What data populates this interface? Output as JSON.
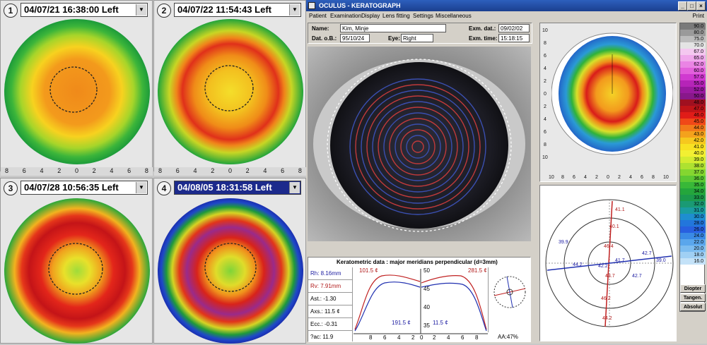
{
  "maps": [
    {
      "num": "1",
      "label": "04/07/21 16:38:00 Left"
    },
    {
      "num": "2",
      "label": "04/07/22 11:54:43 Left"
    },
    {
      "num": "3",
      "label": "04/07/28 10:56:35 Left"
    },
    {
      "num": "4",
      "label": "04/08/05 18:31:58 Left"
    }
  ],
  "scale_ticks": [
    "8",
    "6",
    "4",
    "2",
    "0",
    "2",
    "4",
    "6",
    "8"
  ],
  "window": {
    "title": "OCULUS  -  KERATOGRAPH",
    "print": "Print"
  },
  "menu": [
    "Patient",
    "Examination",
    "Display",
    "Lens fitting",
    "Settings",
    "Miscellaneous"
  ],
  "patient": {
    "name_label": "Name:",
    "name": "Kim, Minje",
    "dob_label": "Dat. o.B.:",
    "dob": "95/10/24",
    "eye_label": "Eye:",
    "eye": "Right",
    "exam_date_label": "Exm. dat.:",
    "exam_date": "09/02/02",
    "exam_time_label": "Exm. time:",
    "exam_time": "15:18:15"
  },
  "kerato": {
    "title": "Keratometric data : major meridians perpendicular (d=3mm)",
    "rows": [
      "Rh:  8.16mm",
      "Rv:  7.91mm",
      "Ast.:  -1.30",
      "Axs.:  11.5 ¢",
      "Ecc.:  -0.31",
      "?ac: 11.9"
    ],
    "left_top": "101.5 ¢",
    "left_bottom": "191.5 ¢",
    "right_top": "281.5 ¢",
    "right_bottom": "11.5 ¢",
    "y_ticks": [
      "50",
      "45",
      "40",
      "35"
    ],
    "x_left": [
      "8",
      "6",
      "4",
      "2",
      "0"
    ],
    "x_right": [
      "2",
      "4",
      "6",
      "8"
    ],
    "aa": "AA:47%"
  },
  "topo_axis": {
    "left": [
      "10",
      "8",
      "6",
      "4",
      "2",
      "0",
      "2",
      "4",
      "6",
      "8",
      "10"
    ],
    "bottom": [
      "10",
      "8",
      "6",
      "4",
      "2",
      "0",
      "2",
      "4",
      "6",
      "8",
      "10"
    ]
  },
  "ring_values": [
    "41.1",
    "40.1",
    "46.4",
    "41.7",
    "42.7",
    "43.7",
    "42.2",
    "39.9",
    "44.2",
    "42.7",
    "39.0",
    "44.2",
    "46.2"
  ],
  "legend": [
    "90.0",
    "80.0",
    "75.0",
    "70.0",
    "67.0",
    "65.0",
    "62.0",
    "60.0",
    "57.0",
    "55.0",
    "52.0",
    "50.0",
    "48.0",
    "47.0",
    "46.0",
    "45.0",
    "44.0",
    "43.0",
    "42.0",
    "41.0",
    "40.0",
    "39.0",
    "38.0",
    "37.0",
    "36.0",
    "35.0",
    "34.0",
    "33.0",
    "32.0",
    "31.0",
    "30.0",
    "28.0",
    "26.0",
    "24.0",
    "22.0",
    "20.0",
    "18.0",
    "16.0"
  ],
  "legend_buttons": [
    "Diopter",
    "Tangen.",
    "Absolut"
  ],
  "colors": {
    "titlebar": "#1b3f8f",
    "select_highlight": "#1c2a8c"
  }
}
